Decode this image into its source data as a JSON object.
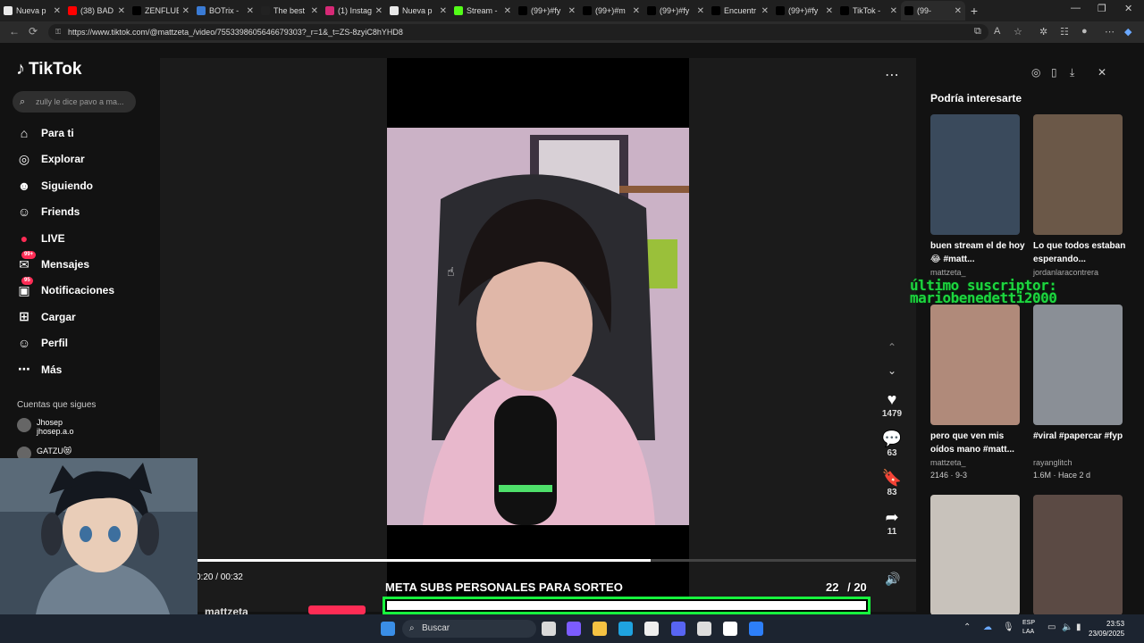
{
  "browser": {
    "tabs": [
      {
        "label": "Nueva p",
        "color": "#e8e8e8"
      },
      {
        "label": "(38) BAD",
        "color": "#ff0000"
      },
      {
        "label": "ZENFLUE",
        "color": "#000000"
      },
      {
        "label": "BOTrix -",
        "color": "#3a7bd5"
      },
      {
        "label": "The best",
        "color": "#222222"
      },
      {
        "label": "(1) Instag",
        "color": "#d62976"
      },
      {
        "label": "Nueva p",
        "color": "#e8e8e8"
      },
      {
        "label": "Stream -",
        "color": "#53fc18"
      },
      {
        "label": "(99+)#fy",
        "color": "#000000"
      },
      {
        "label": "(99+)#m",
        "color": "#000000"
      },
      {
        "label": "(99+)#fy",
        "color": "#000000"
      },
      {
        "label": "Encuentr",
        "color": "#000000"
      },
      {
        "label": "(99+)#fy",
        "color": "#000000"
      },
      {
        "label": "TikTok -",
        "color": "#000000"
      },
      {
        "label": "(99-",
        "color": "#000000"
      }
    ],
    "url": "https://www.tiktok.com/@mattzeta_/video/7553398605646679303?_r=1&_t=ZS-8zyiC8hYHD8"
  },
  "sidebar": {
    "logo": "TikTok",
    "search_placeholder": "zully le dice pavo a ma...",
    "items": [
      {
        "label": "Para ti",
        "icon": "home-icon"
      },
      {
        "label": "Explorar",
        "icon": "compass-icon"
      },
      {
        "label": "Siguiendo",
        "icon": "user-follow-icon"
      },
      {
        "label": "Friends",
        "icon": "friends-icon"
      },
      {
        "label": "LIVE",
        "icon": "live-icon"
      },
      {
        "label": "Mensajes",
        "icon": "message-icon",
        "badge": "99+"
      },
      {
        "label": "Notificaciones",
        "icon": "inbox-icon",
        "badge": "95"
      },
      {
        "label": "Cargar",
        "icon": "upload-icon"
      },
      {
        "label": "Perfil",
        "icon": "profile-icon"
      },
      {
        "label": "Más",
        "icon": "more-icon"
      }
    ],
    "following_heading": "Cuentas que sigues",
    "following": [
      {
        "name": "Jhosep",
        "handle": "jhosep.a.o"
      },
      {
        "name": "GATZU😻",
        "handle": ""
      }
    ]
  },
  "video": {
    "actions": {
      "likes": "1479",
      "comments": "63",
      "saves": "83",
      "shares": "11"
    },
    "progress": 0.63,
    "timecode": "0:20 / 00:32",
    "uploader": "mattzeta_"
  },
  "stream_overlay": {
    "goal_text": "META SUBS PERSONALES PARA SORTEO",
    "goal_current": "22",
    "goal_target": "/ 20",
    "subscriber_line1": "último suscriptor:",
    "subscriber_line2": "mariobenedetti2000"
  },
  "recommendations": {
    "title": "Podría interesarte",
    "items": [
      {
        "caption": "buen stream el de hoy😂 #matt...",
        "author": "mattzeta_",
        "stats": "",
        "thumb": "#3a4a5c"
      },
      {
        "caption": "Lo que todos estaban esperando...",
        "author": "jordanlaracontrera",
        "stats": "",
        "thumb": "#6b5848"
      },
      {
        "caption": "pero que ven mis oídos mano #matt...",
        "author": "mattzeta_",
        "stats": "2146 · 9-3",
        "thumb": "#b08a7a"
      },
      {
        "caption": "#viral #papercar #fyp",
        "author": "rayanglitch",
        "stats": "1.6M · Hace 2 d",
        "thumb": "#8a8f96"
      },
      {
        "caption": "",
        "author": "",
        "stats": "",
        "thumb": "#c8c2bb"
      },
      {
        "caption": "",
        "author": "",
        "stats": "",
        "thumb": "#5b4a44"
      }
    ]
  },
  "taskbar": {
    "search": "Buscar",
    "lang": "ESP\nLAA",
    "time": "23:53",
    "date": "23/09/2025"
  }
}
